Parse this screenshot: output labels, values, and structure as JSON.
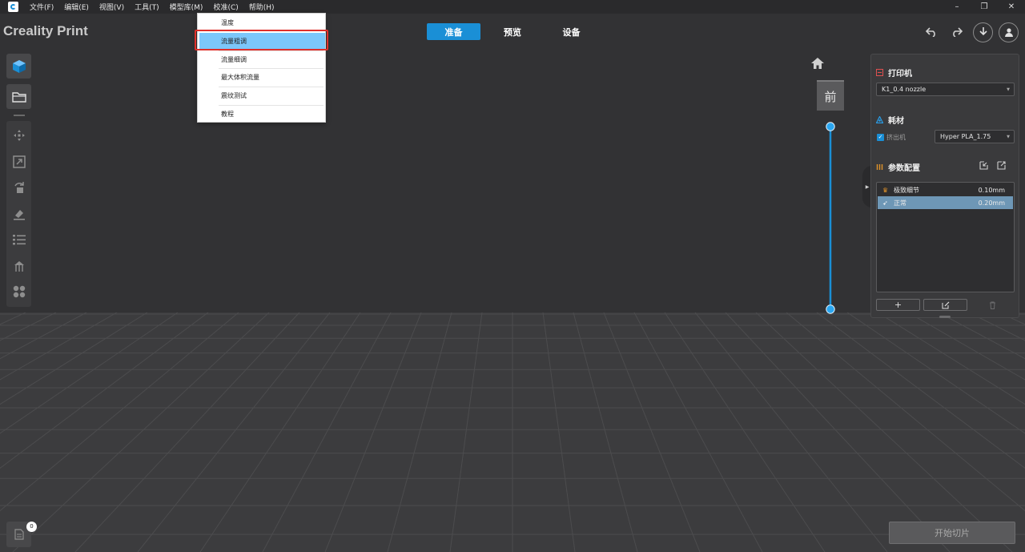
{
  "menubar": {
    "items": [
      "文件(F)",
      "编辑(E)",
      "视图(V)",
      "工具(T)",
      "模型库(M)",
      "校准(C)",
      "帮助(H)"
    ]
  },
  "window_controls": {
    "minimize": "–",
    "restore": "❐",
    "close": "✕"
  },
  "header": {
    "brand": "Creality Print",
    "tabs": [
      "准备",
      "预览",
      "设备"
    ],
    "active_tab": "准备"
  },
  "calibration_menu": {
    "items": [
      "温度",
      "流量粗调",
      "流量细调",
      "最大体积流量",
      "震纹测试",
      "教程"
    ],
    "selected": "流量粗调"
  },
  "view_cube": {
    "label": "前"
  },
  "right_panel": {
    "printer": {
      "title": "打印机",
      "selected": "K1_0.4 nozzle"
    },
    "filament": {
      "title": "耗材",
      "extruder_label": "挤出机",
      "extruder_checked": true,
      "selected": "Hyper PLA_1.75"
    },
    "params": {
      "title": "参数配置",
      "profiles": [
        {
          "name": "极致细节",
          "value": "0.10mm",
          "selected": false
        },
        {
          "name": "正常",
          "value": "0.20mm",
          "selected": true
        }
      ],
      "add_label": "+"
    }
  },
  "bottom": {
    "object_count": "0",
    "slice_button": "开始切片"
  },
  "colors": {
    "accent": "#1a8fd6",
    "menu_highlight": "#7cc7fa",
    "annotation_red": "#e0302a",
    "profile_selected": "#6e97b6"
  }
}
